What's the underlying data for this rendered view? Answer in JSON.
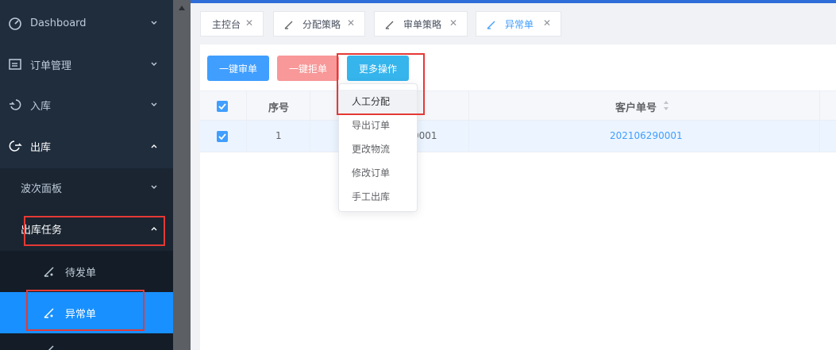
{
  "sidebar": {
    "items": [
      {
        "label": "Dashboard"
      },
      {
        "label": "订单管理"
      },
      {
        "label": "入库"
      },
      {
        "label": "出库"
      }
    ],
    "submenu": {
      "label": "波次面板"
    },
    "submenu2": {
      "label": "出库任务"
    },
    "leaf": [
      {
        "label": "待发单"
      },
      {
        "label": "异常单"
      }
    ]
  },
  "tabs": [
    {
      "label": "主控台"
    },
    {
      "label": "分配策略"
    },
    {
      "label": "审单策略"
    },
    {
      "label": "异常单"
    }
  ],
  "toolbar": {
    "approve": "一键审单",
    "reject": "一键拒单",
    "more": "更多操作"
  },
  "dropdown": {
    "items": [
      "人工分配",
      "导出订单",
      "更改物流",
      "修改订单",
      "手工出库"
    ]
  },
  "table": {
    "headers": {
      "index": "序号",
      "customer_no": "客户单号"
    },
    "rows": [
      {
        "index": "1",
        "order_partial": "0001",
        "customer_no": "202106290001"
      }
    ]
  },
  "colors": {
    "sidebar_bg": "#1f2d3d",
    "active_bg": "#1890ff",
    "primary": "#409eff",
    "reject": "#f89898",
    "more": "#36b4ec",
    "highlight": "#e53935"
  }
}
